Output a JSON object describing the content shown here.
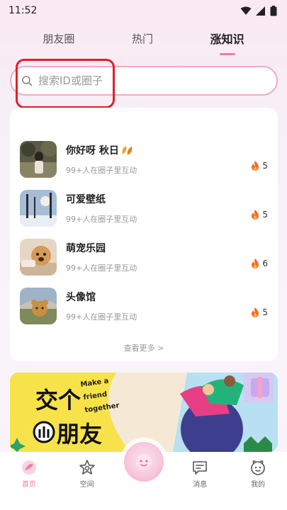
{
  "status_bar": {
    "time": "11:52"
  },
  "tabs": [
    {
      "label": "朋友圈",
      "active": false
    },
    {
      "label": "热门",
      "active": false
    },
    {
      "label": "涨知识",
      "active": true
    }
  ],
  "search": {
    "placeholder": "搜索ID或圈子"
  },
  "circles": [
    {
      "name": "你好呀 秋日",
      "subtitle": "99+人在圈子里互动",
      "heat": "5",
      "thumb_icon": "girl-photo"
    },
    {
      "name": "可爱壁纸",
      "subtitle": "99+人在圈子里互动",
      "heat": "5",
      "thumb_icon": "winter-trees-photo"
    },
    {
      "name": "萌宠乐园",
      "subtitle": "99+人在圈子里互动",
      "heat": "6",
      "thumb_icon": "dog-photo"
    },
    {
      "name": "头像馆",
      "subtitle": "99+人在圈子里互动",
      "heat": "5",
      "thumb_icon": "teddy-bear-photo"
    }
  ],
  "see_more": "查看更多 >",
  "banner": {
    "title_top": "交个",
    "title_bottom": "朋友",
    "tagline_1": "Make a",
    "tagline_2": "friend",
    "tagline_3": "together"
  },
  "bottom_nav": [
    {
      "label": "首页",
      "icon": "home-icon",
      "active": true
    },
    {
      "label": "空间",
      "icon": "star-icon",
      "active": false
    },
    {
      "label": "消息",
      "icon": "message-icon",
      "active": false
    },
    {
      "label": "我的",
      "icon": "profile-icon",
      "active": false
    }
  ],
  "colors": {
    "accent": "#f07aa6",
    "highlight": "#e0202a",
    "flame": "#f26b2a"
  }
}
